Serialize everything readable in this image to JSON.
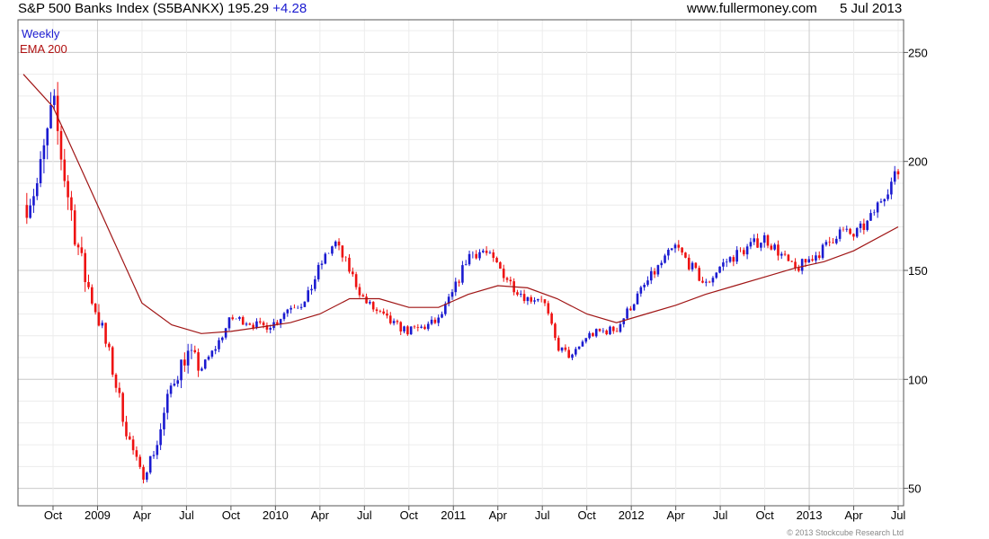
{
  "header": {
    "title": "S&P 500 Banks Index (S5BANKX) 195.29",
    "change": "+4.28",
    "website": "www.fullermoney.com",
    "date": "5 Jul 2013"
  },
  "legend": {
    "period": "Weekly",
    "indicator": "EMA 200"
  },
  "copyright": "© 2013 Stockcube Research Ltd",
  "colors": {
    "up": "#1a1ad0",
    "down": "#ee1111",
    "ema": "#a01515",
    "grid": "#cccccc"
  },
  "chart_data": {
    "type": "line",
    "title": "S&P 500 Banks Index (S5BANKX) 195.29",
    "series": [
      {
        "name": "Weekly",
        "x": [
          "2008-08",
          "2008-09",
          "2008-10",
          "2008-11",
          "2008-12",
          "2009-01",
          "2009-02",
          "2009-03",
          "2009-04",
          "2009-05",
          "2009-06",
          "2009-07",
          "2009-08",
          "2009-09",
          "2009-10",
          "2009-11",
          "2009-12",
          "2010-01",
          "2010-02",
          "2010-03",
          "2010-04",
          "2010-05",
          "2010-06",
          "2010-07",
          "2010-08",
          "2010-09",
          "2010-10",
          "2010-11",
          "2010-12",
          "2011-01",
          "2011-02",
          "2011-03",
          "2011-04",
          "2011-05",
          "2011-06",
          "2011-07",
          "2011-08",
          "2011-09",
          "2011-10",
          "2011-11",
          "2011-12",
          "2012-01",
          "2012-02",
          "2012-03",
          "2012-04",
          "2012-05",
          "2012-06",
          "2012-07",
          "2012-08",
          "2012-09",
          "2012-10",
          "2012-11",
          "2012-12",
          "2013-01",
          "2013-02",
          "2013-03",
          "2013-04",
          "2013-05",
          "2013-06",
          "2013-07"
        ],
        "values": [
          180,
          190,
          225,
          185,
          150,
          130,
          105,
          75,
          55,
          70,
          98,
          112,
          105,
          115,
          128,
          127,
          124,
          126,
          134,
          135,
          152,
          163,
          150,
          136,
          130,
          125,
          122,
          124,
          127,
          140,
          157,
          159,
          152,
          143,
          137,
          138,
          115,
          110,
          120,
          122,
          123,
          134,
          144,
          153,
          161,
          152,
          143,
          152,
          157,
          161,
          165,
          158,
          150,
          155,
          160,
          168,
          166,
          172,
          185,
          195
        ]
      },
      {
        "name": "EMA 200",
        "x": [
          "2008-08",
          "2008-10",
          "2008-12",
          "2009-02",
          "2009-04",
          "2009-06",
          "2009-08",
          "2009-10",
          "2009-12",
          "2010-02",
          "2010-04",
          "2010-06",
          "2010-08",
          "2010-10",
          "2010-12",
          "2011-02",
          "2011-04",
          "2011-06",
          "2011-08",
          "2011-10",
          "2011-12",
          "2012-02",
          "2012-04",
          "2012-06",
          "2012-08",
          "2012-10",
          "2012-12",
          "2013-02",
          "2013-04",
          "2013-07"
        ],
        "values": [
          240,
          225,
          195,
          165,
          135,
          125,
          121,
          122,
          124,
          126,
          130,
          137,
          137,
          133,
          133,
          139,
          143,
          142,
          137,
          130,
          126,
          130,
          134,
          139,
          143,
          147,
          151,
          154,
          159,
          170
        ]
      }
    ],
    "ylim": [
      42,
      265
    ],
    "yticks": [
      50,
      100,
      150,
      200,
      250
    ],
    "xticks": [
      "Oct",
      "2009",
      "Apr",
      "Jul",
      "Oct",
      "2010",
      "Apr",
      "Jul",
      "Oct",
      "2011",
      "Apr",
      "Jul",
      "Oct",
      "2012",
      "Apr",
      "Jul",
      "Oct",
      "2013",
      "Apr",
      "Jul"
    ],
    "grid": true,
    "legend": "top-left"
  }
}
